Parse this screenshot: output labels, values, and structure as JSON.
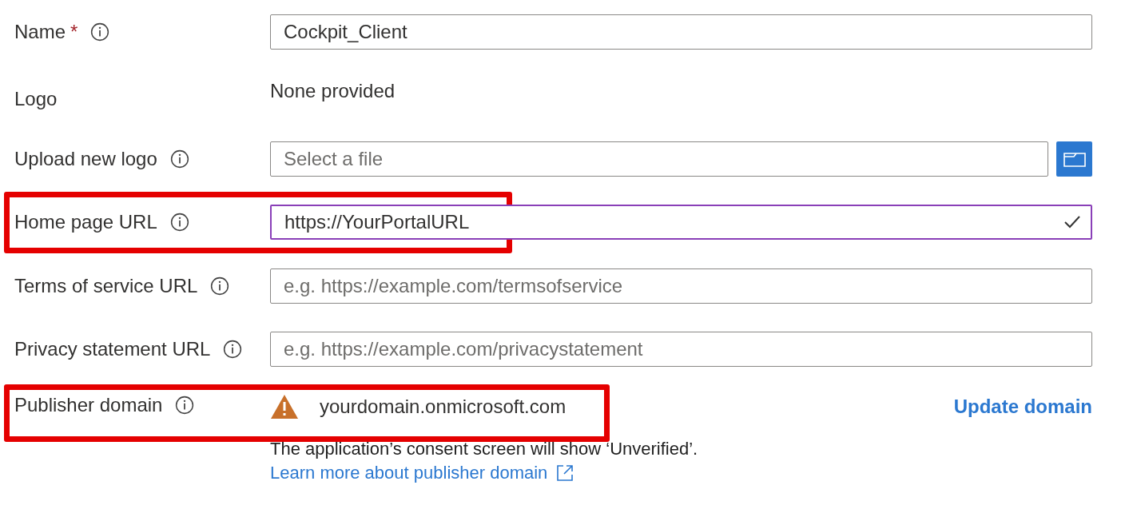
{
  "fields": [
    {
      "kind": "input",
      "label": "Name",
      "required_mark": "*",
      "info": true,
      "value": "Cockpit_Client"
    },
    {
      "kind": "text",
      "label": "Logo",
      "value": "None provided"
    },
    {
      "kind": "file",
      "label": "Upload new logo",
      "info": true,
      "placeholder": "Select a file"
    },
    {
      "kind": "input",
      "label": "Home page URL",
      "info": true,
      "value": "https://YourPortalURL",
      "focused": true,
      "valid": true,
      "highlighted": true
    },
    {
      "kind": "input",
      "label": "Terms of service URL",
      "info": true,
      "placeholder": "e.g. https://example.com/termsofservice"
    },
    {
      "kind": "input",
      "label": "Privacy statement URL",
      "info": true,
      "placeholder": "e.g. https://example.com/privacystatement"
    },
    {
      "kind": "domain",
      "label": "Publisher domain",
      "info": true,
      "value": "yourdomain.onmicrosoft.com",
      "warning": true,
      "action": "Update domain",
      "highlighted": true
    }
  ],
  "note": "The application’s consent screen will show ‘Unverified’.",
  "learn_more": "Learn more about publisher domain"
}
